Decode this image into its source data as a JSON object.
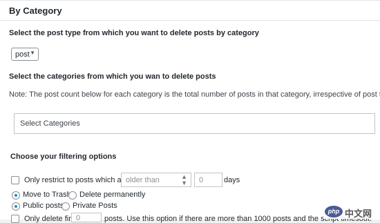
{
  "panel": {
    "title": "By Category"
  },
  "post_type": {
    "instruction": "Select the post type from which you want to delete posts by category",
    "selected": "post",
    "arrow_icon": "▼"
  },
  "categories": {
    "instruction": "Select the categories from which you wan to delete posts",
    "note": "Note: The post count below for each category is the total number of posts in that category, irrespective of post type.",
    "placeholder": "Select Categories"
  },
  "filtering": {
    "heading": "Choose your filtering options",
    "restrict_label": "Only restrict to posts which are",
    "age_select": {
      "selected": "older than",
      "arrows": "▲▼"
    },
    "days_value": "0",
    "days_unit": "days",
    "action_options": [
      {
        "label": "Move to Trash",
        "selected": true
      },
      {
        "label": "Delete permanently",
        "selected": false
      }
    ],
    "visibility_options": [
      {
        "label": "Public posts",
        "selected": true
      },
      {
        "label": "Private Posts",
        "selected": false
      }
    ],
    "batch": {
      "label_start": "Only delete first",
      "value": "0",
      "label_end": "posts. Use this option if there are more than 1000 posts and the script timesout."
    }
  },
  "watermark": {
    "logo": "php",
    "text": "中文网"
  },
  "colors": {
    "accent": "#1e8cbe",
    "border": "#8c8f94",
    "text": "#23282d"
  }
}
